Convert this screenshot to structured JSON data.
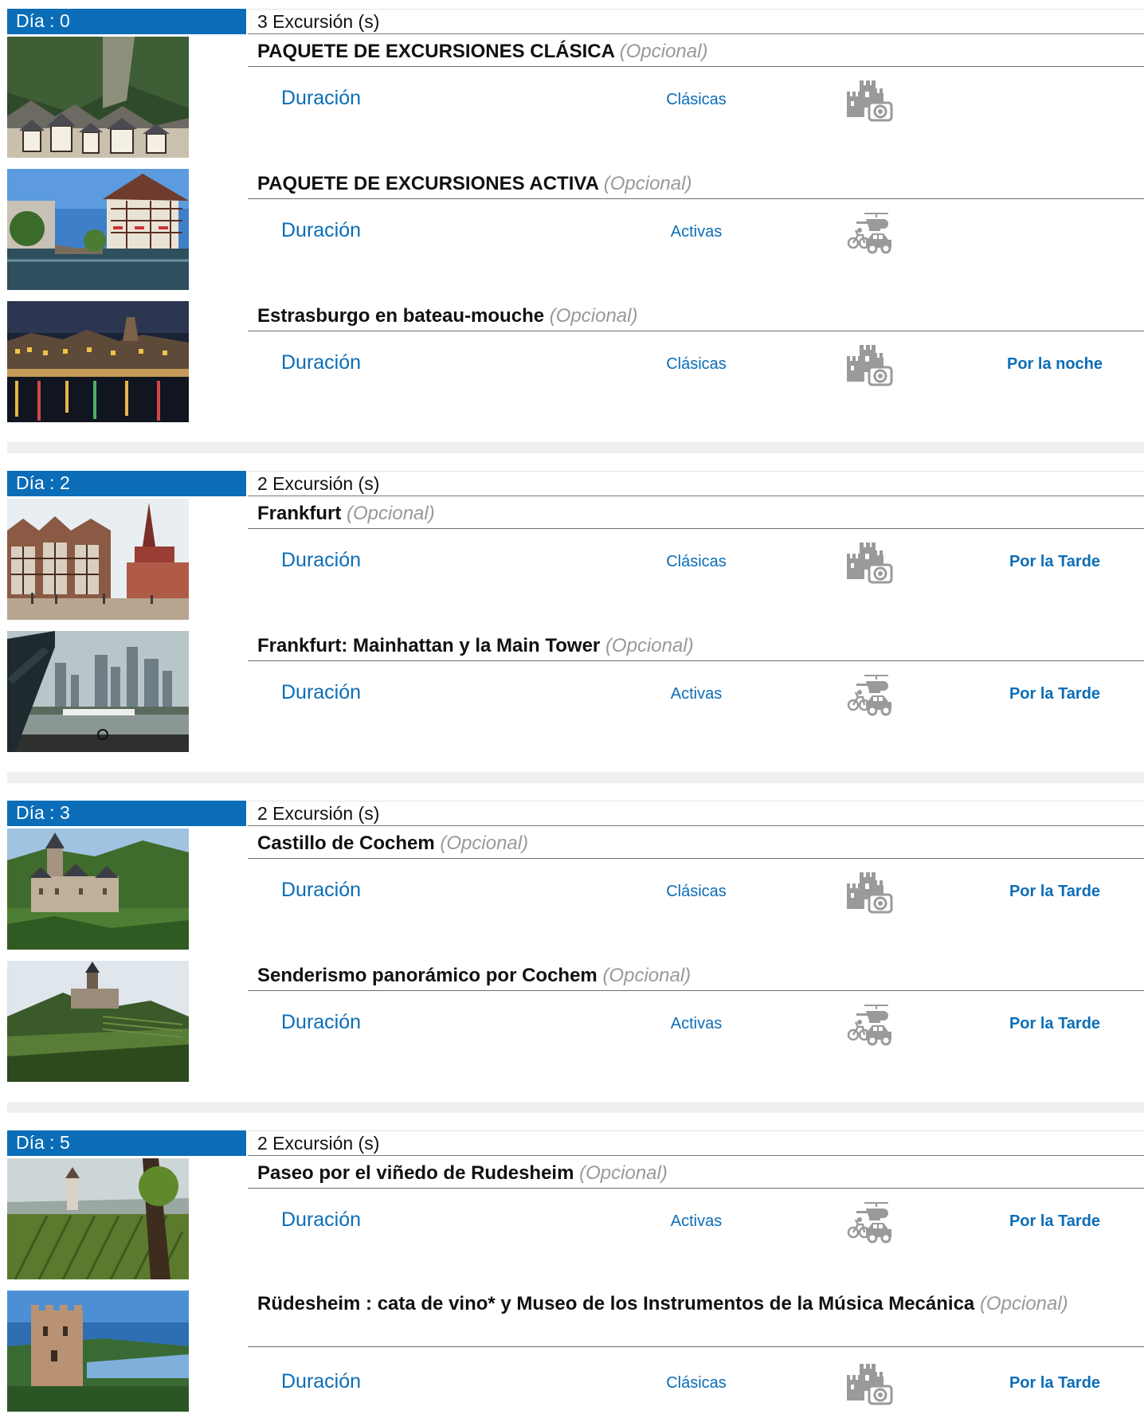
{
  "days": [
    {
      "label": "Día : 0",
      "count": "3 Excursión (s)",
      "excursions": [
        {
          "title": "PAQUETE DE EXCURSIONES CLÁSICA",
          "optional": "(Opcional)",
          "duration_label": "Duración",
          "category": "Clásicas",
          "icon": "castle-camera-icon",
          "time": "",
          "image": "half-timbered-village-hillside"
        },
        {
          "title": "PAQUETE DE EXCURSIONES ACTIVA",
          "optional": "(Opcional)",
          "duration_label": "Duración",
          "category": "Activas",
          "icon": "helicopter-bike-car-icon",
          "time": "",
          "image": "strasbourg-petite-france-canal"
        },
        {
          "title": "Estrasburgo en bateau-mouche",
          "optional": "(Opcional)",
          "duration_label": "Duración",
          "category": "Clásicas",
          "icon": "castle-camera-icon",
          "time": "Por la noche",
          "image": "strasbourg-night-river"
        }
      ]
    },
    {
      "label": "Día : 2",
      "count": "2 Excursión (s)",
      "excursions": [
        {
          "title": "Frankfurt",
          "optional": "(Opcional)",
          "duration_label": "Duración",
          "category": "Clásicas",
          "icon": "castle-camera-icon",
          "time": "Por la Tarde",
          "image": "frankfurt-romerberg-square"
        },
        {
          "title": "Frankfurt: Mainhattan y la Main Tower",
          "optional": "(Opcional)",
          "duration_label": "Duración",
          "category": "Activas",
          "icon": "helicopter-bike-car-icon",
          "time": "Por la Tarde",
          "image": "frankfurt-skyline-river"
        }
      ]
    },
    {
      "label": "Día : 3",
      "count": "2 Excursión (s)",
      "excursions": [
        {
          "title": "Castillo de Cochem",
          "optional": "(Opcional)",
          "duration_label": "Duración",
          "category": "Clásicas",
          "icon": "castle-camera-icon",
          "time": "Por la Tarde",
          "image": "cochem-castle"
        },
        {
          "title": "Senderismo panorámico por Cochem",
          "optional": "(Opcional)",
          "duration_label": "Duración",
          "category": "Activas",
          "icon": "helicopter-bike-car-icon",
          "time": "Por la Tarde",
          "image": "cochem-castle-hill"
        }
      ]
    },
    {
      "label": "Día : 5",
      "count": "2 Excursión (s)",
      "excursions": [
        {
          "title": "Paseo por el viñedo de Rudesheim",
          "optional": "(Opcional)",
          "duration_label": "Duración",
          "category": "Activas",
          "icon": "helicopter-bike-car-icon",
          "time": "Por la Tarde",
          "image": "rudesheim-vineyard"
        },
        {
          "title": "Rüdesheim : cata de vino* y Museo de los Instrumentos de la Música Mecánica",
          "optional": "(Opcional)",
          "duration_label": "Duración",
          "category": "Clásicas",
          "icon": "castle-camera-icon",
          "time": "Por la Tarde",
          "image": "rudesheim-tower-ruin"
        }
      ]
    }
  ],
  "colors": {
    "accent": "#0b6db7",
    "muted": "#999999",
    "separator": "#efefef"
  }
}
